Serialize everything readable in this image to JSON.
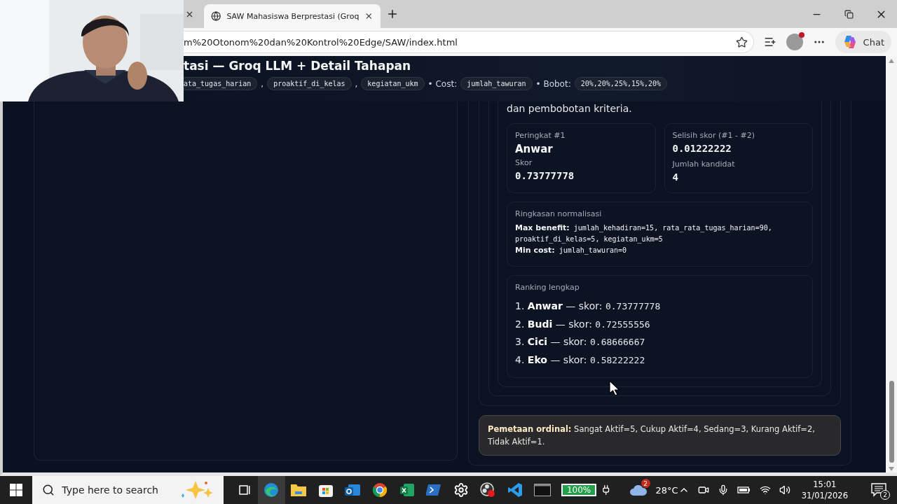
{
  "browser": {
    "tabs": [
      {
        "title": "SAW Mahasiswa Berprestasi (Groq",
        "selected": true
      }
    ],
    "address_bar": {
      "url": "m%20Otonom%20dan%20Kontrol%20Edge/SAW/index.html"
    },
    "chat_button": "Chat"
  },
  "header": {
    "title": "tasi — Groq LLM + Detail Tahapan",
    "criteria": [
      {
        "kind": "chip",
        "text": "ata_tugas_harian"
      },
      {
        "kind": "text",
        "text": ","
      },
      {
        "kind": "chip",
        "text": "proaktif_di_kelas"
      },
      {
        "kind": "text",
        "text": ","
      },
      {
        "kind": "chip",
        "text": "kegiatan_ukm"
      },
      {
        "kind": "text",
        "text": "• Cost:"
      },
      {
        "kind": "chip",
        "text": "jumlah_tawuran"
      },
      {
        "kind": "text",
        "text": "• Bobot:"
      },
      {
        "kind": "chip",
        "text": "20%,20%,25%,15%,20%"
      }
    ]
  },
  "result": {
    "intro": "dan pembobotan kriteria.",
    "stats": [
      {
        "fields": [
          {
            "kind": "label",
            "text": "Peringkat #1"
          },
          {
            "kind": "name",
            "text": "Anwar"
          },
          {
            "kind": "label",
            "text": "Skor"
          },
          {
            "kind": "number",
            "text": "0.73777778"
          }
        ]
      },
      {
        "fields": [
          {
            "kind": "label",
            "text": "Selisih skor (#1 - #2)"
          },
          {
            "kind": "number",
            "text": "0.01222222"
          },
          {
            "kind": "label",
            "text": "Jumlah kandidat"
          },
          {
            "kind": "number",
            "text": "4"
          }
        ]
      }
    ],
    "normalization": {
      "title": "Ringkasan normalisasi",
      "lines": [
        "**Max benefit:** jumlah_kehadiran=15, rata_rata_tugas_harian=90, proaktif_di_kelas=5, kegiatan_ukm=5",
        "**Min cost:** jumlah_tawuran=0"
      ]
    },
    "ranking": {
      "title": "Ranking lengkap",
      "items": [
        {
          "rank": "1.",
          "name": "Anwar",
          "connector": "— skor:",
          "score": "0.73777778"
        },
        {
          "rank": "2.",
          "name": "Budi",
          "connector": "— skor:",
          "score": "0.72555556"
        },
        {
          "rank": "3.",
          "name": "Cici",
          "connector": "— skor:",
          "score": "0.68666667"
        },
        {
          "rank": "4.",
          "name": "Eko",
          "connector": "— skor:",
          "score": "0.58222222"
        }
      ]
    },
    "note": "**Pemetaan ordinal:** Sangat Aktif=5, Cukup Aktif=4, Sedang=3, Kurang Aktif=2, Tidak Aktif=1."
  },
  "taskbar": {
    "search_placeholder": "Type here to search",
    "battery": "100%",
    "weather": {
      "badge": "2",
      "temperature": "28°C"
    },
    "clock": {
      "time": "15:01",
      "date": "31/01/2026"
    },
    "notifications": "2"
  }
}
